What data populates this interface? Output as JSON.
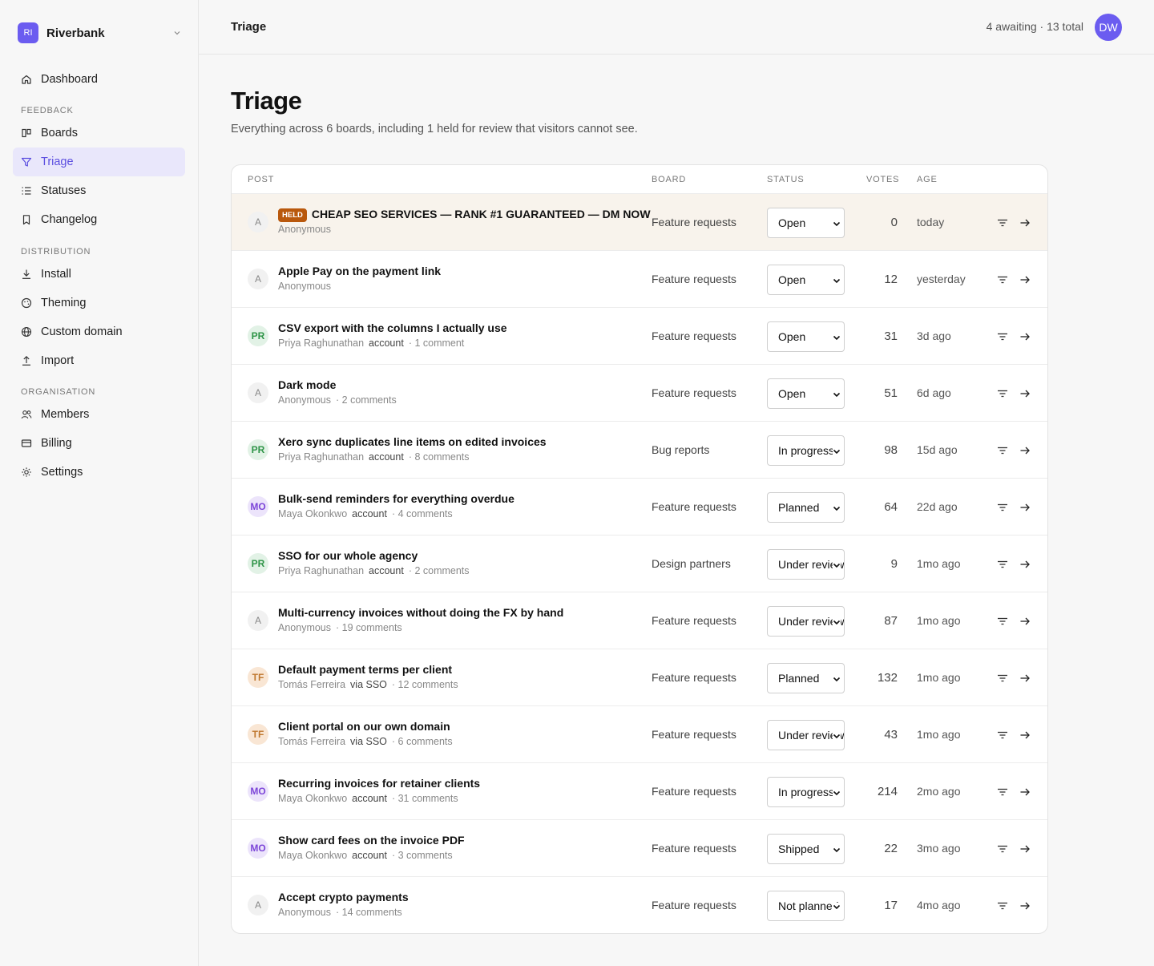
{
  "workspace": {
    "initials": "RI",
    "name": "Riverbank"
  },
  "nav": {
    "dashboard": "Dashboard",
    "feedback_section": "FEEDBACK",
    "boards": "Boards",
    "triage": "Triage",
    "statuses": "Statuses",
    "changelog": "Changelog",
    "distribution_section": "DISTRIBUTION",
    "install": "Install",
    "theming": "Theming",
    "custom_domain": "Custom domain",
    "import": "Import",
    "organisation_section": "ORGANISATION",
    "members": "Members",
    "billing": "Billing",
    "settings": "Settings"
  },
  "topbar": {
    "title": "Triage",
    "meta": "4 awaiting · 13 total",
    "user_initials": "DW"
  },
  "header": {
    "title": "Triage",
    "subtitle": "Everything across 6 boards, including 1 held for review that visitors cannot see."
  },
  "table": {
    "columns": {
      "post": "POST",
      "board": "BOARD",
      "status": "STATUS",
      "votes": "VOTES",
      "age": "AGE"
    },
    "rows": [
      {
        "initials": "A",
        "held": "HELD",
        "title": "CHEAP SEO SERVICES — RANK #1 GUARANTEED — DM NOW",
        "author": "Anonymous",
        "tag": "",
        "comments": "",
        "board": "Feature requests",
        "status": "Open",
        "votes": "0",
        "age": "today"
      },
      {
        "initials": "A",
        "held": "",
        "title": "Apple Pay on the payment link",
        "author": "Anonymous",
        "tag": "",
        "comments": "",
        "board": "Feature requests",
        "status": "Open",
        "votes": "12",
        "age": "yesterday"
      },
      {
        "initials": "PR",
        "held": "",
        "title": "CSV export with the columns I actually use",
        "author": "Priya Raghunathan",
        "tag": "account",
        "comments": "· 1 comment",
        "board": "Feature requests",
        "status": "Open",
        "votes": "31",
        "age": "3d ago"
      },
      {
        "initials": "A",
        "held": "",
        "title": "Dark mode",
        "author": "Anonymous",
        "tag": "",
        "comments": "· 2 comments",
        "board": "Feature requests",
        "status": "Open",
        "votes": "51",
        "age": "6d ago"
      },
      {
        "initials": "PR",
        "held": "",
        "title": "Xero sync duplicates line items on edited invoices",
        "author": "Priya Raghunathan",
        "tag": "account",
        "comments": "· 8 comments",
        "board": "Bug reports",
        "status": "In progress",
        "votes": "98",
        "age": "15d ago"
      },
      {
        "initials": "MO",
        "held": "",
        "title": "Bulk-send reminders for everything overdue",
        "author": "Maya Okonkwo",
        "tag": "account",
        "comments": "· 4 comments",
        "board": "Feature requests",
        "status": "Planned",
        "votes": "64",
        "age": "22d ago"
      },
      {
        "initials": "PR",
        "held": "",
        "title": "SSO for our whole agency",
        "author": "Priya Raghunathan",
        "tag": "account",
        "comments": "· 2 comments",
        "board": "Design partners",
        "status": "Under review",
        "votes": "9",
        "age": "1mo ago"
      },
      {
        "initials": "A",
        "held": "",
        "title": "Multi-currency invoices without doing the FX by hand",
        "author": "Anonymous",
        "tag": "",
        "comments": "· 19 comments",
        "board": "Feature requests",
        "status": "Under review",
        "votes": "87",
        "age": "1mo ago"
      },
      {
        "initials": "TF",
        "held": "",
        "title": "Default payment terms per client",
        "author": "Tomás Ferreira",
        "tag": "via SSO",
        "comments": "· 12 comments",
        "board": "Feature requests",
        "status": "Planned",
        "votes": "132",
        "age": "1mo ago"
      },
      {
        "initials": "TF",
        "held": "",
        "title": "Client portal on our own domain",
        "author": "Tomás Ferreira",
        "tag": "via SSO",
        "comments": "· 6 comments",
        "board": "Feature requests",
        "status": "Under review",
        "votes": "43",
        "age": "1mo ago"
      },
      {
        "initials": "MO",
        "held": "",
        "title": "Recurring invoices for retainer clients",
        "author": "Maya Okonkwo",
        "tag": "account",
        "comments": "· 31 comments",
        "board": "Feature requests",
        "status": "In progress",
        "votes": "214",
        "age": "2mo ago"
      },
      {
        "initials": "MO",
        "held": "",
        "title": "Show card fees on the invoice PDF",
        "author": "Maya Okonkwo",
        "tag": "account",
        "comments": "· 3 comments",
        "board": "Feature requests",
        "status": "Shipped",
        "votes": "22",
        "age": "3mo ago"
      },
      {
        "initials": "A",
        "held": "",
        "title": "Accept crypto payments",
        "author": "Anonymous",
        "tag": "",
        "comments": "· 14 comments",
        "board": "Feature requests",
        "status": "Not planned",
        "votes": "17",
        "age": "4mo ago"
      }
    ]
  },
  "colors": {
    "accent": "#6b5cf0",
    "held_badge": "#b9580c",
    "held_row": "#f8f3ec",
    "nav_active_bg": "#e9e7fb"
  }
}
